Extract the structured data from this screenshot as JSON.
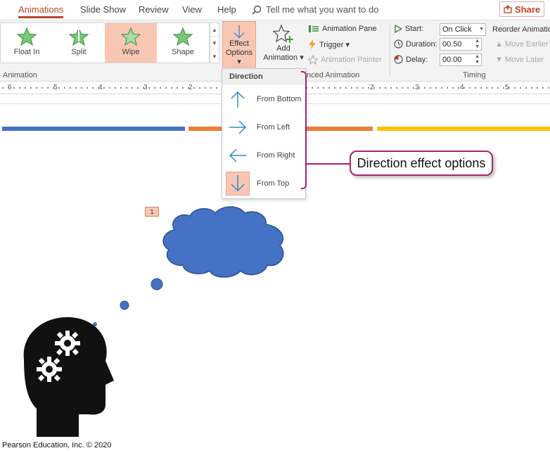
{
  "tabs": [
    {
      "label": "Animations",
      "active": true
    },
    {
      "label": "Slide Show"
    },
    {
      "label": "Review"
    },
    {
      "label": "View"
    },
    {
      "label": "Help"
    }
  ],
  "tell_me": "Tell me what you want to do",
  "share": "Share",
  "ribbon": {
    "animations": [
      "Float In",
      "Split",
      "Wipe",
      "Shape"
    ],
    "selected_animation": "Wipe",
    "effect_options": {
      "line1": "Effect",
      "line2": "Options"
    },
    "add_animation": {
      "line1": "Add",
      "line2": "Animation"
    },
    "animation_pane": "Animation Pane",
    "trigger": "Trigger",
    "animation_painter": "Animation Painter",
    "start_label": "Start:",
    "start_value": "On Click",
    "duration_label": "Duration:",
    "duration_value": "00.50",
    "delay_label": "Delay:",
    "delay_value": "00.00",
    "reorder_title": "Reorder Animation",
    "move_earlier": "Move Earlier",
    "move_later": "Move Later",
    "group_animation": "Animation",
    "group_advanced": "nced Animation",
    "group_timing": "Timing"
  },
  "ruler": [
    "6",
    "5",
    "4",
    "3",
    "2",
    "2",
    "3",
    "4",
    "5"
  ],
  "dropdown": {
    "header": "Direction",
    "items": [
      {
        "label": "From Bottom",
        "icon": "arrow-up-icon"
      },
      {
        "label": "From Left",
        "icon": "arrow-right-icon"
      },
      {
        "label": "From Right",
        "icon": "arrow-left-icon"
      },
      {
        "label": "From Top",
        "icon": "arrow-down-icon",
        "selected": true
      }
    ]
  },
  "callout": "Direction effect options",
  "slide": {
    "animation_tag": "1",
    "bar_colors": [
      "#4472c4",
      "#ed7d31",
      "#ffc000"
    ],
    "cloud_color": "#4472c4"
  },
  "credit": "Pearson Education, Inc. © 2020",
  "colors": {
    "accent": "#b7472a",
    "selected": "#f8c7b3",
    "callout": "#a8246e",
    "icon_blue": "#2e8bc9"
  }
}
